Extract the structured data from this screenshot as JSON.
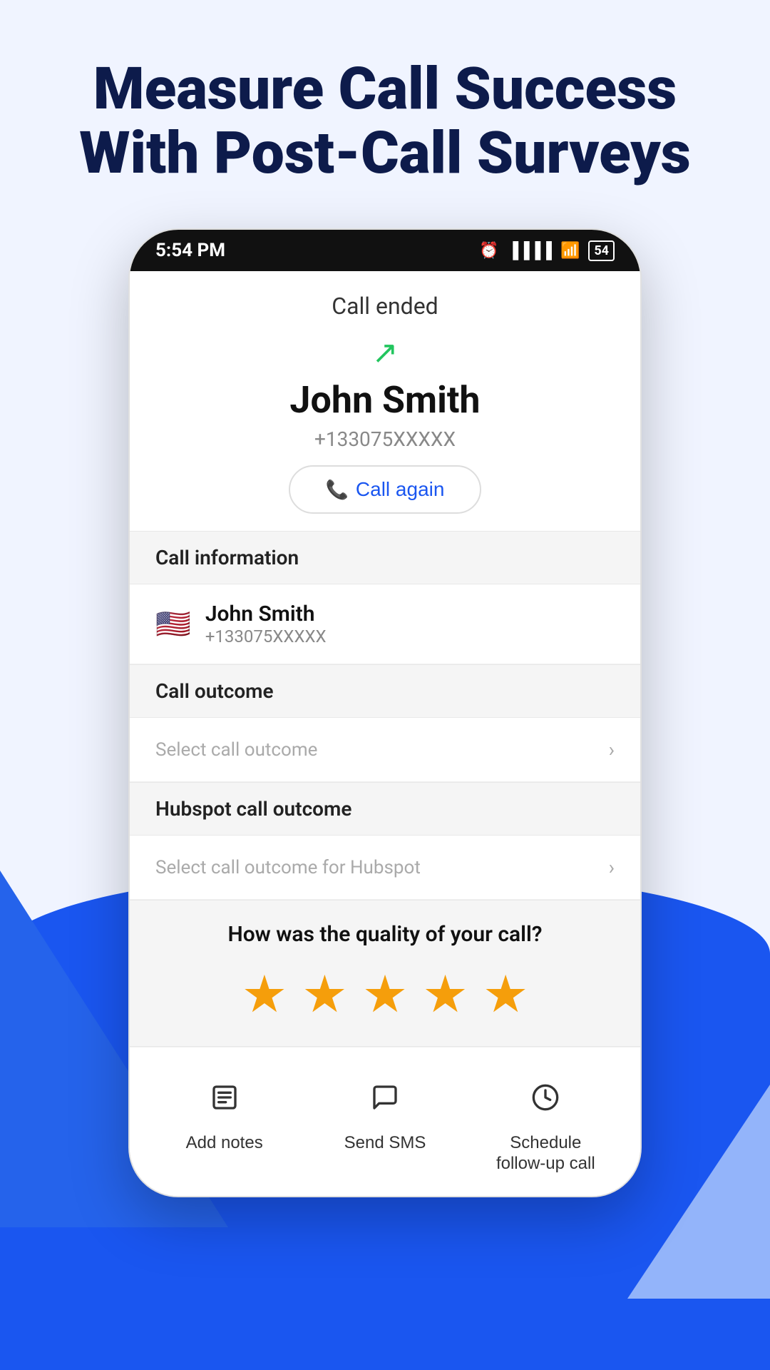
{
  "page": {
    "headline_line1": "Measure Call Success",
    "headline_line2": "With Post-Call Surveys"
  },
  "status_bar": {
    "time": "5:54 PM",
    "battery": "54"
  },
  "call_screen": {
    "call_ended_label": "Call ended",
    "caller_name": "John Smith",
    "caller_number": "+133075XXXXX",
    "call_again_label": "Call again"
  },
  "call_information": {
    "section_title": "Call information",
    "contact_name": "John Smith",
    "contact_number": "+133075XXXXX",
    "flag": "🇺🇸"
  },
  "call_outcome": {
    "section_title": "Call outcome",
    "placeholder": "Select call outcome"
  },
  "hubspot_outcome": {
    "section_title": "Hubspot call outcome",
    "placeholder": "Select call outcome for Hubspot"
  },
  "quality": {
    "title": "How was the quality of your call?",
    "stars": [
      1,
      2,
      3,
      4,
      5
    ]
  },
  "actions": {
    "add_notes": "Add notes",
    "send_sms": "Send SMS",
    "schedule": "Schedule\nfollow-up call"
  }
}
